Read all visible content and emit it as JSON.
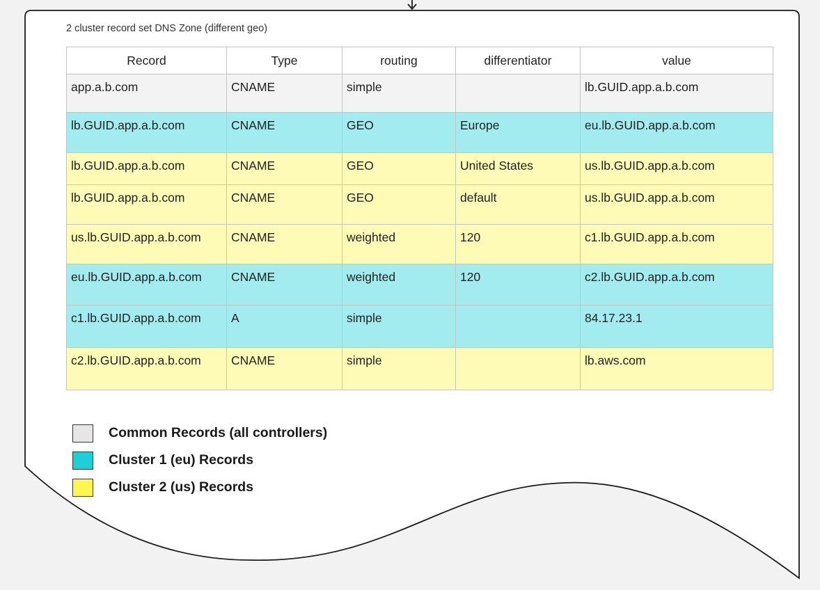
{
  "caption": "2 cluster record set DNS Zone (different geo)",
  "colors": {
    "common": "#f3f3f3",
    "eu": "#a2ebee",
    "us": "#fdfbb5",
    "swatch_common": "#e6e6e6",
    "swatch_eu": "#1fcfd8",
    "swatch_us": "#fff64f"
  },
  "table": {
    "headers": [
      "Record",
      "Type",
      "routing",
      "differentiator",
      "value"
    ],
    "rows": [
      {
        "group": "common",
        "cells": [
          "app.a.b.com",
          "CNAME",
          "simple",
          "",
          "lb.GUID.app.a.b.com"
        ]
      },
      {
        "group": "eu",
        "cells": [
          "lb.GUID.app.a.b.com",
          "CNAME",
          "GEO",
          "Europe",
          "eu.lb.GUID.app.a.b.com"
        ]
      },
      {
        "group": "us",
        "cells": [
          "lb.GUID.app.a.b.com",
          "CNAME",
          "GEO",
          "United States",
          "us.lb.GUID.app.a.b.com"
        ]
      },
      {
        "group": "us",
        "cells": [
          "lb.GUID.app.a.b.com",
          "CNAME",
          "GEO",
          "default",
          "us.lb.GUID.app.a.b.com"
        ]
      },
      {
        "group": "us",
        "cells": [
          "us.lb.GUID.app.a.b.com",
          "CNAME",
          "weighted",
          "120",
          "c1.lb.GUID.app.a.b.com"
        ]
      },
      {
        "group": "eu",
        "cells": [
          "eu.lb.GUID.app.a.b.com",
          "CNAME",
          "weighted",
          "120",
          "c2.lb.GUID.app.a.b.com"
        ]
      },
      {
        "group": "eu",
        "cells": [
          "c1.lb.GUID.app.a.b.com",
          "A",
          "simple",
          "",
          "84.17.23.1"
        ]
      },
      {
        "group": "us",
        "cells": [
          "c2.lb.GUID.app.a.b.com",
          "CNAME",
          "simple",
          "",
          "lb.aws.com"
        ]
      }
    ]
  },
  "legend": [
    {
      "key": "common",
      "label": "Common Records (all controllers)"
    },
    {
      "key": "eu",
      "label": "Cluster 1 (eu) Records"
    },
    {
      "key": "us",
      "label": "Cluster 2 (us) Records"
    }
  ]
}
